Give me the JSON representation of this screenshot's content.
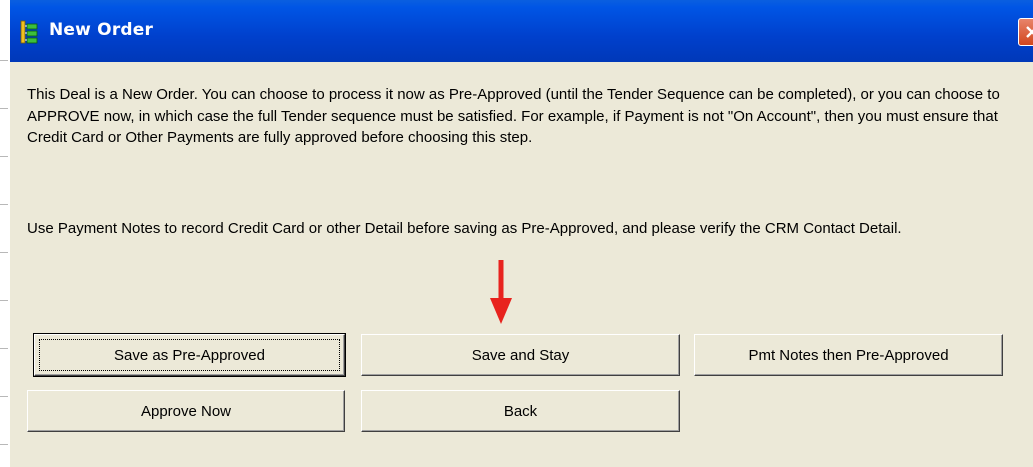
{
  "window": {
    "title": "New Order",
    "icon": "app-tree-icon",
    "close_icon": "close-icon"
  },
  "message": {
    "paragraph1": "This Deal is a New Order. You can choose to process it now as Pre-Approved (until the Tender Sequence can be completed), or you can choose to APPROVE now, in which case the full Tender sequence must be satisfied. For example, if Payment is not \"On Account\", then you must ensure that Credit Card or Other Payments are fully approved before choosing this step.",
    "paragraph2": "Use Payment Notes to record Credit Card or other Detail before saving as Pre-Approved, and please verify the CRM Contact Detail."
  },
  "buttons": {
    "save_pre_approved": "Save as Pre-Approved",
    "save_and_stay": "Save and Stay",
    "pmt_notes_pre_approved": "Pmt Notes then Pre-Approved",
    "approve_now": "Approve Now",
    "back": "Back"
  },
  "colors": {
    "titlebar": "#0055e5",
    "annotation_arrow": "#e8231e",
    "dialog_background": "#ece9d8"
  }
}
